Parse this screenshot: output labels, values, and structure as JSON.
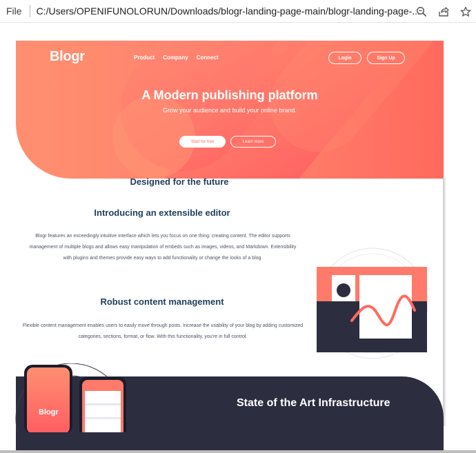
{
  "browser": {
    "scheme_label": "File",
    "url": "C:/Users/OPENIFUNOLORUN/Downloads/blogr-landing-page-main/blogr-landing-page-...",
    "icons": [
      "zoom-icon",
      "share-icon",
      "star-icon"
    ]
  },
  "header": {
    "logo": "Blogr",
    "nav": [
      "Product",
      "Company",
      "Connect"
    ],
    "login_label": "Login",
    "signup_label": "Sign Up"
  },
  "hero": {
    "title": "A Modern publishing platform",
    "subtitle": "Grow your audience and build your online brand.",
    "start_label": "Start for free",
    "learn_label": "Learn more"
  },
  "section": {
    "title": "Designed for the future",
    "intro_heading": "Introducing an extensible editor",
    "intro_body": "Blogr features an exceedingly intuitive interface which lets you focus on one thing: creating content. The editor supports management of multiple blogs and allows easy manipulation of embeds such as images, videos, and Markdown. Extensibility with plugins and themes provide easy ways to add functionality or change the looks of a blog.",
    "robust_heading": "Robust content management",
    "robust_body": "Flexible content management enables users to easily move through posts. Increase the usability of your blog by adding customized categories, sections, format, or flow. With this functionality, you're in full control."
  },
  "infrastructure": {
    "title": "State of the Art Infrastructure",
    "phone_logo": "Blogr"
  },
  "colors": {
    "hero_start": "#ff8f70",
    "hero_end": "#ff6a5d",
    "heading": "#1f3e5a",
    "dark_band": "#2c2d3f"
  }
}
